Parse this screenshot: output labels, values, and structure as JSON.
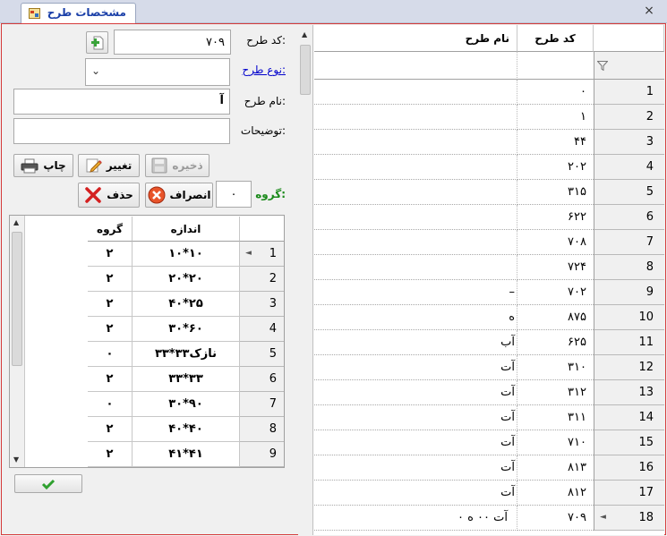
{
  "window": {
    "tab_title": "مشخصات طرح",
    "close_glyph": "×"
  },
  "form": {
    "code_label": "کد طرح:",
    "code_value": "۷۰۹",
    "type_label": "نوع طرح:",
    "type_value": "",
    "name_label": "نام طرح:",
    "name_value": "آ",
    "desc_label": "توضیحات:",
    "desc_value": "",
    "group_label": "گروه:",
    "group_value": "۰"
  },
  "buttons": {
    "save": "ذخیره",
    "edit": "تغییر",
    "print": "چاپ",
    "cancel": "انصراف",
    "delete": "حذف"
  },
  "sizes_grid": {
    "headers": {
      "size": "اندازه",
      "group": "گروه"
    },
    "rows": [
      {
        "num": "1",
        "size": "۱۰*۱۰",
        "group": "۲"
      },
      {
        "num": "2",
        "size": "۲۰*۲۰",
        "group": "۲"
      },
      {
        "num": "3",
        "size": "۴۰*۲۵",
        "group": "۲"
      },
      {
        "num": "4",
        "size": "۳۰*۶۰",
        "group": "۲"
      },
      {
        "num": "5",
        "size": "۳۳*۳۳نازک",
        "group": "۰"
      },
      {
        "num": "6",
        "size": "۳۳*۳۳",
        "group": "۲"
      },
      {
        "num": "7",
        "size": "۳۰*۹۰",
        "group": "۰"
      },
      {
        "num": "8",
        "size": "۴۰*۴۰",
        "group": "۲"
      },
      {
        "num": "9",
        "size": "۴۱*۴۱",
        "group": "۲"
      }
    ]
  },
  "designs_grid": {
    "headers": {
      "code": "کد طرح",
      "name": "نام طرح"
    },
    "rows": [
      {
        "num": "1",
        "code": "۰",
        "name": ""
      },
      {
        "num": "2",
        "code": "۱",
        "name": ""
      },
      {
        "num": "3",
        "code": "۴۴",
        "name": ""
      },
      {
        "num": "4",
        "code": "۲۰۲",
        "name": ""
      },
      {
        "num": "5",
        "code": "۳۱۵",
        "name": ""
      },
      {
        "num": "6",
        "code": "۶۲۲",
        "name": ""
      },
      {
        "num": "7",
        "code": "۷۰۸",
        "name": ""
      },
      {
        "num": "8",
        "code": "۷۲۴",
        "name": ""
      },
      {
        "num": "9",
        "code": "۷۰۲",
        "name": "–"
      },
      {
        "num": "10",
        "code": "۸۷۵",
        "name": "ه"
      },
      {
        "num": "11",
        "code": "۶۲۵",
        "name": "آب"
      },
      {
        "num": "12",
        "code": "۳۱۰",
        "name": "آت"
      },
      {
        "num": "13",
        "code": "۳۱۲",
        "name": "آت"
      },
      {
        "num": "14",
        "code": "۳۱۱",
        "name": "آت"
      },
      {
        "num": "15",
        "code": "۷۱۰",
        "name": "آت"
      },
      {
        "num": "16",
        "code": "۸۱۳",
        "name": "آت"
      },
      {
        "num": "17",
        "code": "۸۱۲",
        "name": "آت"
      },
      {
        "num": "18",
        "code": "۷۰۹",
        "name": "آت ۰۰ ه ۰"
      }
    ]
  },
  "colors": {
    "tab_title": "#1a3fa8",
    "group_label": "#1a8a1a",
    "link_label": "#0000cc",
    "frame_border": "#d53a3a"
  }
}
